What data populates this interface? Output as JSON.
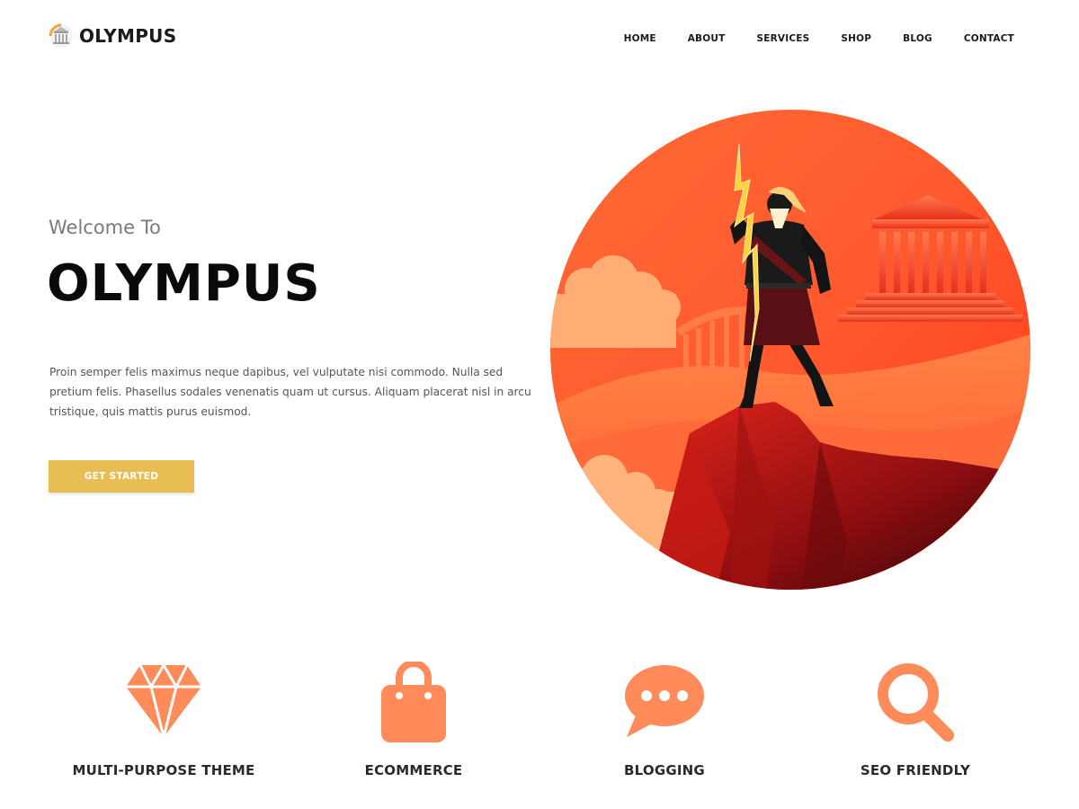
{
  "brand": {
    "name": "OLYMPUS",
    "logo_icon": "temple-column-icon"
  },
  "nav": {
    "items": [
      {
        "label": "HOME"
      },
      {
        "label": "ABOUT"
      },
      {
        "label": "SERVICES"
      },
      {
        "label": "SHOP"
      },
      {
        "label": "BLOG"
      },
      {
        "label": "CONTACT"
      }
    ]
  },
  "hero": {
    "welcome": "Welcome To",
    "title": "OLYMPUS",
    "description": "Proin semper felis maximus neque dapibus, vel vulputate nisi commodo. Nulla sed pretium felis. Phasellus sodales venenatis quam ut cursus. Aliquam placerat nisl in arcu tristique, quis mattis purus euismod.",
    "cta_label": "GET STARTED",
    "image": "zeus-on-mountain-illustration"
  },
  "features": [
    {
      "label": "MULTI-PURPOSE THEME",
      "icon": "diamond-icon"
    },
    {
      "label": "ECOMMERCE",
      "icon": "shopping-bag-icon"
    },
    {
      "label": "BLOGGING",
      "icon": "chat-bubble-icon"
    },
    {
      "label": "SEO FRIENDLY",
      "icon": "magnifier-icon"
    }
  ],
  "colors": {
    "accent": "#e8bd54",
    "icon": "#ff8a5a",
    "text_dark": "#1a1a1a"
  }
}
